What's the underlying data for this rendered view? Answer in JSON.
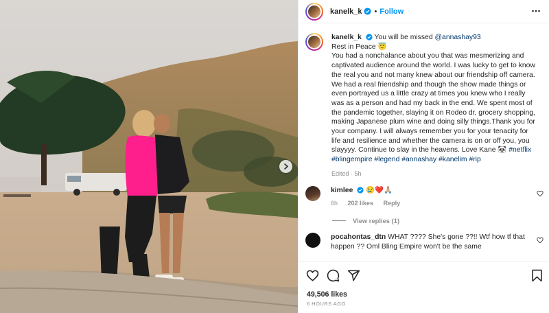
{
  "post": {
    "author": "kanelk_k",
    "follow_label": "Follow",
    "dot": "•"
  },
  "caption": {
    "author": "kanelk_k",
    "line_first": "You will be missed",
    "mention": "@annashay93",
    "line_rip": "Rest in Peace",
    "emoji_rip": "😇",
    "body": "You had a nonchalance about you that was mesmerizing and captivated audience around the world. I was lucky to get to know the real you and not many knew about our friendship off camera. We had a real friendship and though the show made things or even portrayed us a little crazy at times you knew who I really was as a person and had my back in the end. We spent most of the pandemic together, slaying it on Rodeo dr, grocery shopping, making Japanese plum wine and doing silly things.Thank you for your company. I will always remember you for your tenacity for life and resilience and whether the camera is on or off you, you slayyyy. Continue to slay in the heavens. Love Kane",
    "emoji_panda": "🐼",
    "tag_1": "#netflix",
    "tags_rest": "#blingempire #legend #annashay #kanelim #rip",
    "meta": "Edited · 5h"
  },
  "comments": [
    {
      "user": "kimlee",
      "text": "😢❤️🙏🏼",
      "age": "6h",
      "likes": "202 likes",
      "reply": "Reply",
      "view_replies": "View replies (1)"
    },
    {
      "user": "pocahontas_dtn",
      "text": "WHAT ???? She's gone ??!! Wtf how tf that happen ?? Oml Bling Empire won't be the same"
    }
  ],
  "footer": {
    "likes": "49,506 likes",
    "time": "6 HOURS AGO"
  },
  "colors": {
    "link": "#00376b",
    "follow": "#0095f6",
    "verified": "#0095f6",
    "muted": "#8e8e8e"
  },
  "icons": [
    "chevron-right-icon",
    "verified-icon",
    "more-icon",
    "heart-icon",
    "comment-icon",
    "share-icon",
    "bookmark-icon"
  ]
}
